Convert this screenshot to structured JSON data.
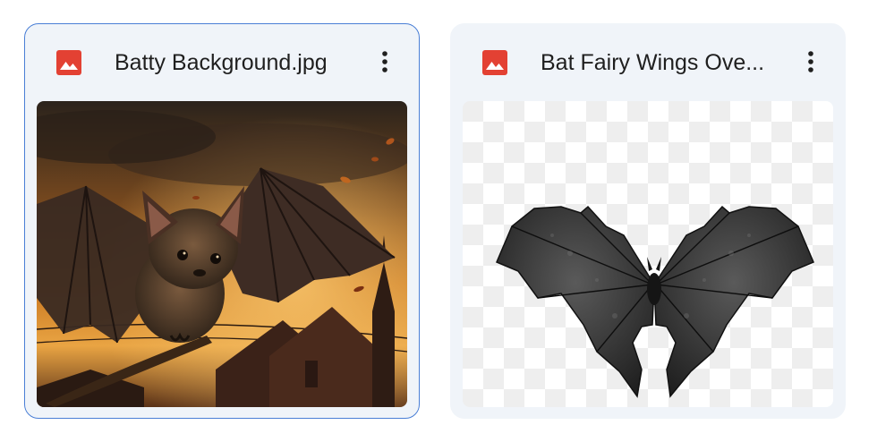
{
  "files": [
    {
      "name": "Batty Background.jpg",
      "file_type_icon": "image-file-icon",
      "menu_icon": "more-vert-icon",
      "thumbnail": "bat-flying-sunset-thumbnail",
      "selected": true
    },
    {
      "name": "Bat Fairy Wings Ove...",
      "file_type_icon": "image-file-icon",
      "menu_icon": "more-vert-icon",
      "thumbnail": "bat-wings-transparent-thumbnail",
      "selected": false
    }
  ],
  "colors": {
    "file_icon_red": "#d93025",
    "card_background": "#f0f4f9",
    "selected_border": "#4a7fd6",
    "text": "#1f1f1f"
  }
}
